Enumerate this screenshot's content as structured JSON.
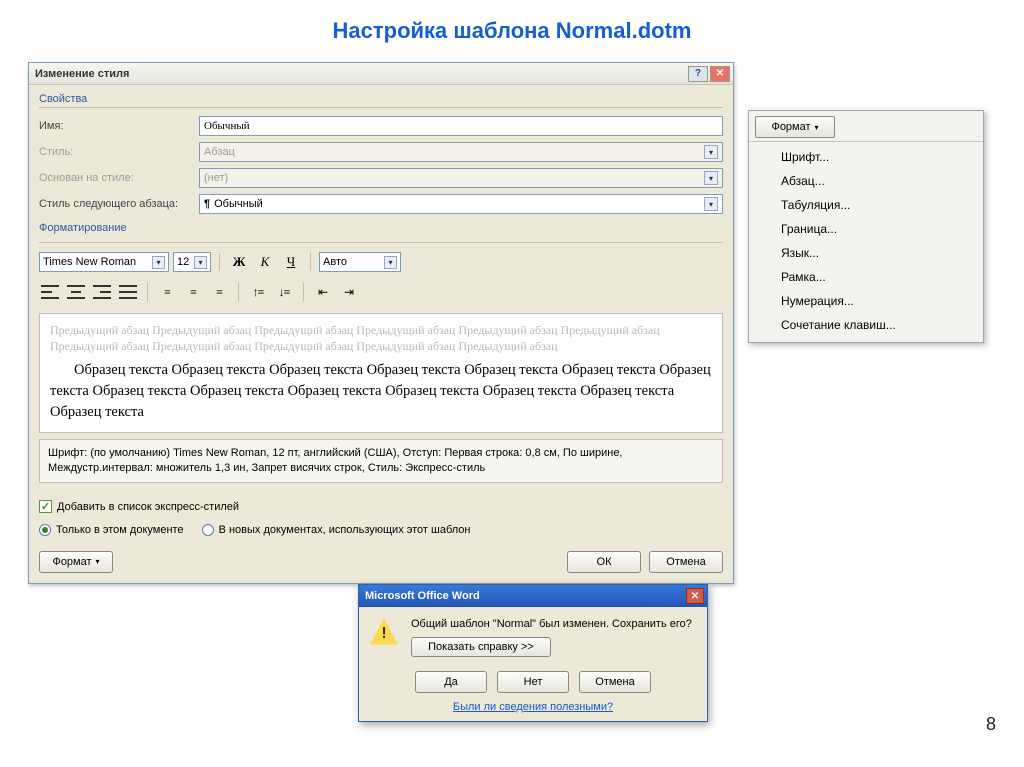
{
  "slide": {
    "title": "Настройка шаблона Normal.dotm",
    "page": "8"
  },
  "dialog": {
    "title": "Изменение стиля",
    "sections": {
      "properties": "Свойства",
      "formatting": "Форматирование"
    },
    "fields": {
      "name_label": "Имя:",
      "name_value": "Обычный",
      "style_label": "Стиль:",
      "style_value": "Абзац",
      "based_label": "Основан на стиле:",
      "based_value": "(нет)",
      "next_label": "Стиль следующего абзаца:",
      "next_value": "Обычный"
    },
    "toolbar": {
      "font": "Times New Roman",
      "size": "12",
      "bold": "Ж",
      "italic": "К",
      "underline": "Ч",
      "color": "Авто"
    },
    "preview": {
      "ghost": "Предыдущий абзац Предыдущий абзац Предыдущий абзац Предыдущий абзац Предыдущий абзац Предыдущий абзац Предыдущий абзац Предыдущий абзац Предыдущий абзац Предыдущий абзац Предыдущий абзац",
      "sample": "Образец текста Образец текста Образец текста Образец текста Образец текста Образец текста Образец текста Образец текста Образец текста Образец текста Образец текста Образец текста Образец текста Образец текста"
    },
    "description": "Шрифт: (по умолчанию) Times New Roman, 12 пт, английский (США), Отступ: Первая строка:  0,8 см, По ширине, Междустр.интервал: множитель 1,3 ин, Запрет висячих строк, Стиль: Экспресс-стиль",
    "checkbox": "Добавить в список экспресс-стилей",
    "radio1": "Только в этом документе",
    "radio2": "В новых документах, использующих этот шаблон",
    "buttons": {
      "format": "Формат",
      "ok": "ОК",
      "cancel": "Отмена"
    }
  },
  "format_menu": {
    "button": "Формат",
    "items": [
      "Шрифт...",
      "Абзац...",
      "Табуляция...",
      "Граница...",
      "Язык...",
      "Рамка...",
      "Нумерация...",
      "Сочетание клавиш..."
    ]
  },
  "save_prompt": {
    "title": "Microsoft Office Word",
    "message": "Общий шаблон \"Normal\" был изменен.  Сохранить его?",
    "help_button": "Показать справку >>",
    "yes": "Да",
    "no": "Нет",
    "cancel": "Отмена",
    "link": "Были ли сведения полезными?"
  }
}
